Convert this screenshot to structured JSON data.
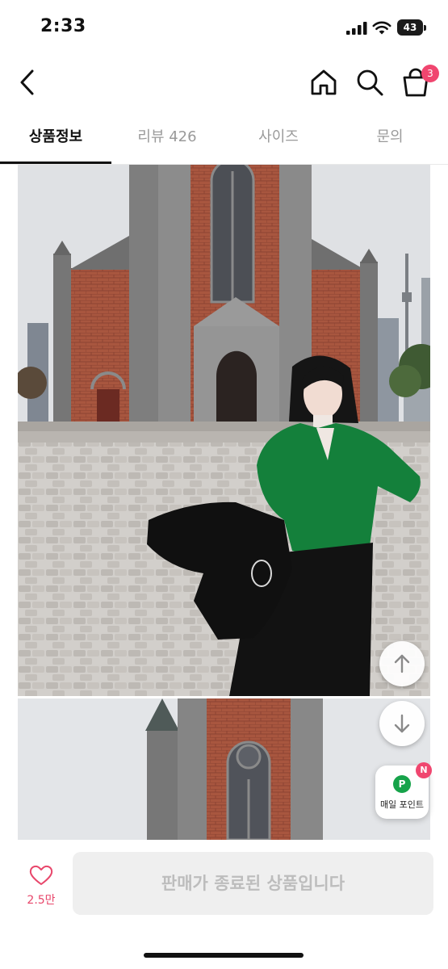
{
  "status_bar": {
    "time": "2:33",
    "battery": "43"
  },
  "header": {
    "icons": [
      "back-icon",
      "home-icon",
      "search-icon",
      "cart-icon"
    ],
    "cart_count": "3"
  },
  "tabs": [
    {
      "label": "상품정보",
      "active": true
    },
    {
      "label": "리뷰 426",
      "active": false
    },
    {
      "label": "사이즈",
      "active": false
    },
    {
      "label": "문의",
      "active": false
    }
  ],
  "floating": {
    "scroll_up_icon": "arrow-up-icon",
    "scroll_down_icon": "arrow-down-icon",
    "points_icon_letter": "P",
    "points_label": "매일 포인트",
    "points_badge": "N"
  },
  "bottom_bar": {
    "like_count": "2.5만",
    "buy_label": "판매가 종료된 상품입니다"
  },
  "colors": {
    "accent_pink": "#f0466f",
    "points_green": "#16a34a",
    "disabled_button_bg": "#efefef",
    "disabled_button_text": "#bdbdbd"
  }
}
